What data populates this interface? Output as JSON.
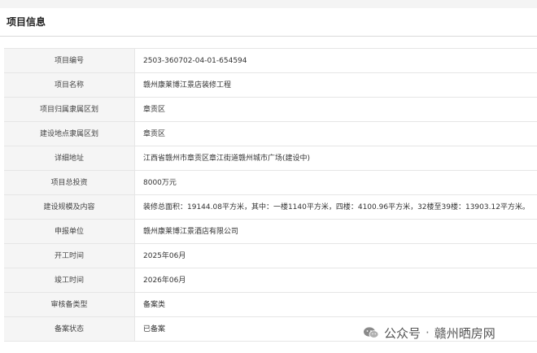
{
  "section": {
    "title": "项目信息"
  },
  "rows": [
    {
      "label": "项目编号",
      "value": "2503-360702-04-01-654594"
    },
    {
      "label": "项目名称",
      "value": "赣州康莱博江景店装修工程"
    },
    {
      "label": "项目归属隶属区划",
      "value": "章贡区"
    },
    {
      "label": "建设地点隶属区划",
      "value": "章贡区"
    },
    {
      "label": "详细地址",
      "value": "江西省赣州市章贡区章江街道赣州城市广场(建设中)"
    },
    {
      "label": "项目总投资",
      "value": "8000万元"
    },
    {
      "label": "建设规模及内容",
      "value": "装修总面积：19144.08平方米，其中：一楼1140平方米，四楼：4100.96平方米，32楼至39楼：13903.12平方米。"
    },
    {
      "label": "申报单位",
      "value": "赣州康莱博江景酒店有限公司"
    },
    {
      "label": "开工时间",
      "value": "2025年06月"
    },
    {
      "label": "竣工时间",
      "value": "2026年06月"
    },
    {
      "label": "审核备类型",
      "value": "备案类"
    },
    {
      "label": "备案状态",
      "value": "已备案"
    }
  ],
  "watermark": {
    "icon": "wechat-icon",
    "prefix": "公众号",
    "dot": "·",
    "name": "赣州晒房网"
  }
}
